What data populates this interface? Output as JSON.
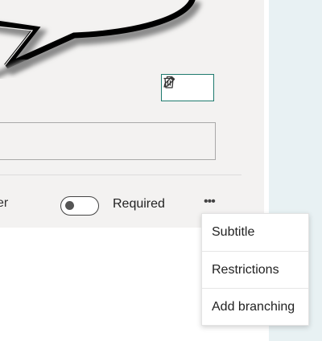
{
  "question": {
    "image_tools": [
      {
        "icon": "pencil-icon",
        "action": "edit"
      },
      {
        "icon": "trash-icon",
        "action": "delete"
      }
    ],
    "answer_placeholder": "",
    "footer": {
      "left_fragment": "er",
      "required_label": "Required",
      "required_on": false,
      "more_label": "•••"
    }
  },
  "more_menu": {
    "items": [
      {
        "label": "Subtitle"
      },
      {
        "label": "Restrictions"
      },
      {
        "label": "Add branching"
      }
    ]
  },
  "colors": {
    "card_bg": "#f3f2f1",
    "side_panel": "#e8f1f3",
    "accent_border": "#1f7a6e"
  }
}
